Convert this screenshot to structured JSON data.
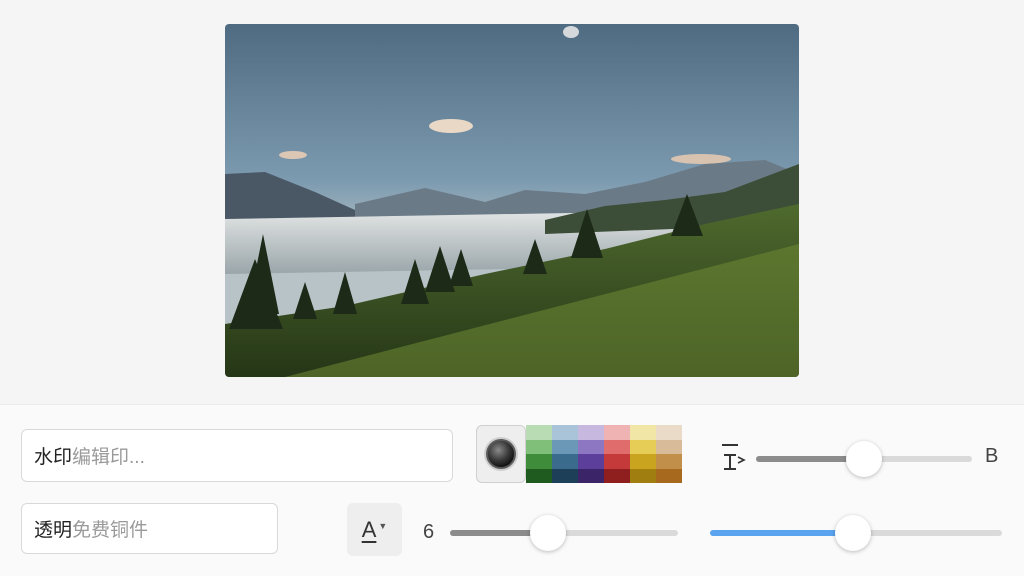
{
  "watermark_input": {
    "value": "水印",
    "placeholder": "编辑印..."
  },
  "transparency_input": {
    "value": "透明",
    "placeholder": "免费铜件"
  },
  "font_button": {
    "label": "A"
  },
  "size_value": "6",
  "letter_b": "B",
  "palette": [
    [
      "#b9dcb4",
      "#7fbf7a",
      "#3f8c3b",
      "#1f5a1e"
    ],
    [
      "#a9c4d9",
      "#6c98b8",
      "#3a6a8c",
      "#1d3f57"
    ],
    [
      "#c6b8df",
      "#8d77c2",
      "#5b3f9a",
      "#3b2467"
    ],
    [
      "#efb3b3",
      "#e06c6c",
      "#c43a3a",
      "#8f1f1f"
    ],
    [
      "#f2e6a6",
      "#e6cd55",
      "#c9a51f",
      "#a07e10"
    ],
    [
      "#eadbc8",
      "#d8bc99",
      "#c28f4a",
      "#a6691d"
    ]
  ],
  "sliders": {
    "text_height": {
      "value": 0.5,
      "fill": "#8c8c8c"
    },
    "size": {
      "value": 0.43,
      "fill": "#8c8c8c"
    },
    "opacity": {
      "value": 0.49,
      "fill": "#5aa3ee"
    }
  },
  "colors": {
    "accent": "#5aa3ee"
  }
}
